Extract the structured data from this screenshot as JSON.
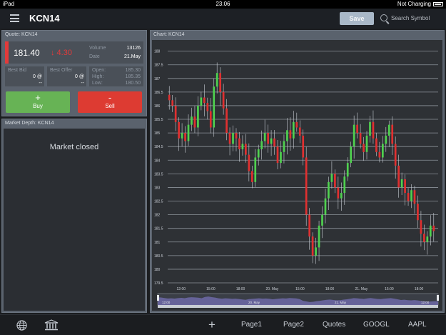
{
  "status_bar": {
    "device": "iPad",
    "time": "23:06",
    "charging": "Not Charging"
  },
  "header": {
    "title": "KCN14",
    "save_label": "Save",
    "search_placeholder": "Search Symbol",
    "menu_icon": "hamburger-icon"
  },
  "quote": {
    "panel_title": "Quote: KCN14",
    "last": "181.40",
    "change": "↓ 4.30",
    "volume_label": "Volume",
    "volume": "13126",
    "date_label": "Date",
    "date": "21.May",
    "best_bid_label": "Best Bid",
    "best_bid": "0 @",
    "best_bid_size": "--",
    "best_offer_label": "Best Offer",
    "best_offer": "0 @",
    "best_offer_size": "--",
    "open_label": "Open:",
    "open": "185.30",
    "high_label": "High:",
    "high": "185.35",
    "low_label": "Low:",
    "low": "180.50",
    "buy_symbol": "+",
    "buy_label": "Buy",
    "sell_symbol": "-",
    "sell_label": "Sell",
    "colors": {
      "up": "#67b355",
      "down": "#dd3b32"
    }
  },
  "depth": {
    "panel_title": "Market Depth: KCN14",
    "message": "Market closed"
  },
  "chart_panel": {
    "panel_title": "Chart: KCN14"
  },
  "chart_data": {
    "type": "candlestick",
    "y_ticks": [
      "179.5",
      "180",
      "180.5",
      "181",
      "181.5",
      "182",
      "182.5",
      "183",
      "183.5",
      "184",
      "184.5",
      "185",
      "185.5",
      "186",
      "186.5",
      "187",
      "187.5",
      "188"
    ],
    "ylim": [
      179.5,
      188.2
    ],
    "x_ticks": [
      "12:00",
      "15:00",
      "18:00",
      "20. May",
      "15:00",
      "18:00",
      "21. May",
      "15:00",
      "18:00"
    ],
    "nav_labels": [
      "12:00",
      "20. May",
      "21. May",
      "12:00"
    ],
    "closes": [
      186.2,
      186.0,
      185.4,
      184.8,
      185.0,
      184.7,
      185.3,
      185.6,
      185.2,
      186.0,
      186.3,
      186.1,
      185.8,
      185.2,
      186.7,
      187.2,
      186.5,
      185.9,
      185.0,
      184.6,
      185.0,
      184.8,
      184.4,
      184.6,
      184.2,
      183.6,
      183.2,
      184.1,
      184.4,
      184.7,
      185.0,
      184.6,
      184.8,
      184.5,
      183.9,
      184.3,
      184.7,
      185.1,
      184.8,
      185.4,
      185.2,
      184.9,
      184.1,
      182.0,
      181.2,
      180.5,
      180.8,
      181.6,
      182.0,
      182.6,
      183.2,
      183.5,
      183.0,
      182.6,
      182.8,
      183.4,
      183.9,
      184.5,
      185.3,
      185.0,
      184.6,
      184.3,
      184.9,
      185.4,
      184.8,
      184.3,
      184.1,
      184.6,
      184.9,
      185.3,
      184.6,
      183.8,
      183.0,
      183.3,
      182.8,
      182.5,
      182.9,
      182.4,
      181.8,
      181.3,
      181.0,
      181.2,
      181.6,
      181.4
    ],
    "session_volume_label": "volume navigator",
    "colors": {
      "up": "#4fd14f",
      "down": "#e03030",
      "background": "#2e3135",
      "grid": "#8c929a"
    }
  },
  "bottom_nav": {
    "globe_icon": "globe-icon",
    "bank_icon": "bank-icon",
    "add_icon": "+",
    "items": [
      "Page1",
      "Page2",
      "Quotes",
      "GOOGL",
      "AAPL"
    ]
  }
}
